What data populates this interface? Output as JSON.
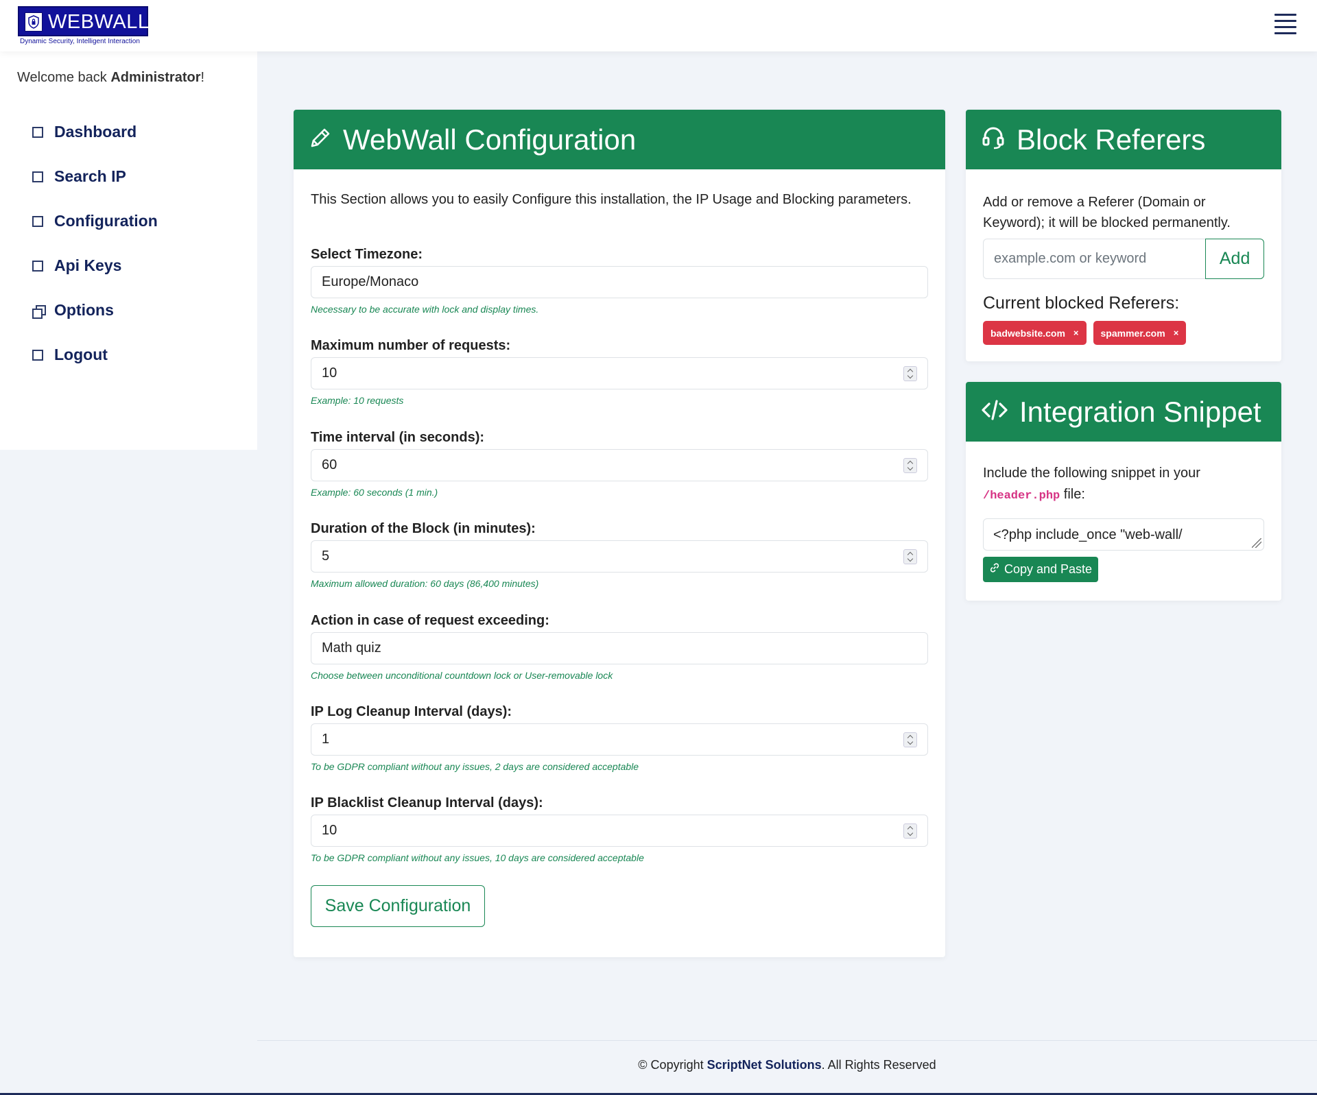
{
  "header": {
    "logo_word": "WEBWALL",
    "logo_tagline": "Dynamic Security, Intelligent Interaction",
    "menu_icon": "hamburger-menu-icon"
  },
  "sidebar": {
    "welcome_prefix": "Welcome back ",
    "welcome_user": "Administrator",
    "welcome_suffix": "!",
    "items": [
      {
        "label": "Dashboard",
        "icon": "square-icon"
      },
      {
        "label": "Search IP",
        "icon": "square-icon"
      },
      {
        "label": "Configuration",
        "icon": "square-icon"
      },
      {
        "label": "Api Keys",
        "icon": "square-icon"
      },
      {
        "label": "Options",
        "icon": "windows-icon"
      },
      {
        "label": "Logout",
        "icon": "square-icon"
      }
    ]
  },
  "config": {
    "title": "WebWall Configuration",
    "title_icon": "pencil-icon",
    "intro": "This Section allows you to easily Configure this installation, the IP Usage and Blocking parameters.",
    "fields": [
      {
        "label": "Select Timezone:",
        "value": "Europe/Monaco",
        "help": "Necessary to be accurate with lock and display times."
      },
      {
        "label": "Maximum number of requests:",
        "value": "10",
        "help": "Example: 10 requests"
      },
      {
        "label": "Time interval (in seconds):",
        "value": "60",
        "help": "Example: 60 seconds (1 min.)"
      },
      {
        "label": "Duration of the Block (in minutes):",
        "value": "5",
        "help": "Maximum allowed duration: 60 days (86,400 minutes)"
      },
      {
        "label": "Action in case of request exceeding:",
        "value": "Math quiz",
        "help": "Choose between unconditional countdown lock or User-removable lock"
      },
      {
        "label": "IP Log Cleanup Interval (days):",
        "value": "1",
        "help": "To be GDPR compliant without any issues, 2 days are considered acceptable"
      },
      {
        "label": "IP Blacklist Cleanup Interval (days):",
        "value": "10",
        "help": "To be GDPR compliant without any issues, 10 days are considered acceptable"
      }
    ],
    "save_label": "Save Configuration"
  },
  "referers": {
    "title": "Block Referers",
    "title_icon": "headset-icon",
    "description": "Add or remove a Referer (Domain or Keyword); it will be blocked permanently.",
    "input_placeholder": "example.com or keyword",
    "add_label": "Add",
    "current_title": "Current blocked Referers:",
    "blocked": [
      "badwebsite.com",
      "spammer.com"
    ],
    "remove_symbol": "×"
  },
  "snippet": {
    "title": "Integration Snippet",
    "title_icon": "code-icon",
    "desc_prefix": "Include the following snippet in your",
    "desc_code": "/header.php",
    "desc_suffix": " file:",
    "code": "<?php include_once \"web-wall/",
    "copy_label": "Copy and Paste",
    "copy_icon": "link-icon"
  },
  "footer": {
    "prefix": "© Copyright ",
    "company": "ScriptNet Solutions",
    "suffix": ". All Rights Reserved"
  },
  "colors": {
    "accent": "#198754",
    "danger": "#dc3545",
    "brand": "#11119a",
    "nav_text": "#13235b"
  }
}
